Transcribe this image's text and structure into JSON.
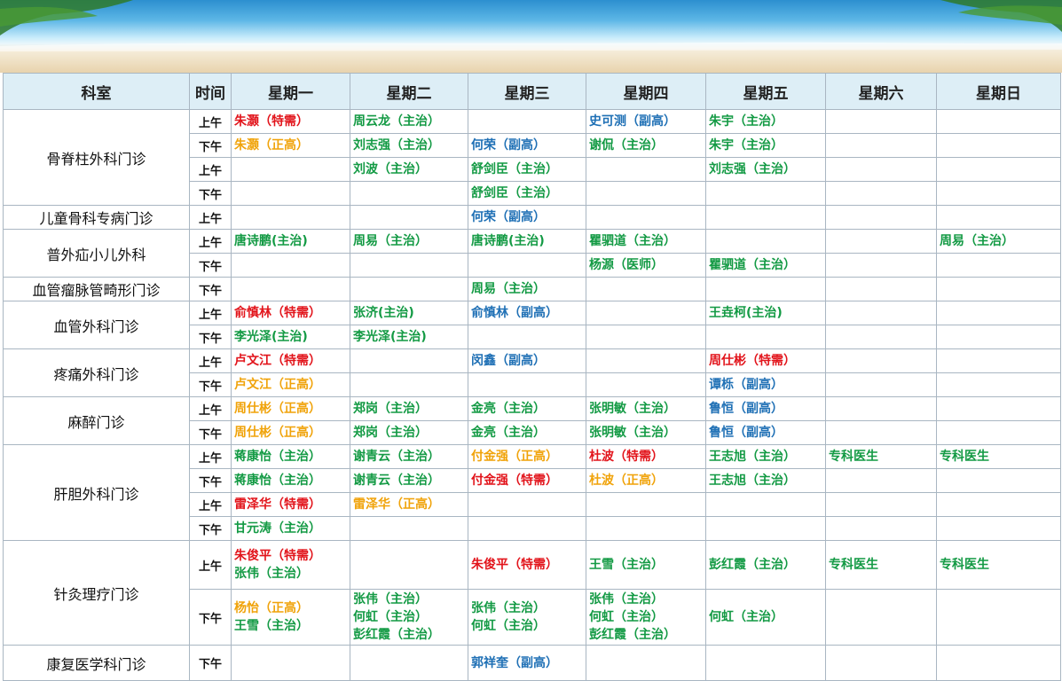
{
  "colors": {
    "red": "#e2141b",
    "green": "#139a44",
    "blue": "#1f70b5",
    "orange": "#f0a30a",
    "header_bg": "#ddeef6",
    "border": "#a9b6c2"
  },
  "headers": [
    "科室",
    "时间",
    "星期一",
    "星期二",
    "星期三",
    "星期四",
    "星期五",
    "星期六",
    "星期日"
  ],
  "rows": [
    {
      "dept": "骨脊柱外科门诊",
      "time": "上午",
      "cells": [
        [
          [
            "朱灏（特需）",
            "red"
          ]
        ],
        [
          [
            "周云龙（主治）",
            "green"
          ]
        ],
        [],
        [
          [
            "史可测（副高）",
            "blue"
          ]
        ],
        [
          [
            "朱宇（主治）",
            "green"
          ]
        ],
        [],
        []
      ]
    },
    {
      "time": "下午",
      "cells": [
        [
          [
            "朱灏（正高）",
            "orange"
          ]
        ],
        [
          [
            "刘志强（主治）",
            "green"
          ]
        ],
        [
          [
            "何荣（副高）",
            "blue"
          ]
        ],
        [
          [
            "谢侃（主治）",
            "green"
          ]
        ],
        [
          [
            "朱宇（主治）",
            "green"
          ]
        ],
        [],
        []
      ]
    },
    {
      "time": "上午",
      "cells": [
        [],
        [
          [
            "刘波（主治）",
            "green"
          ]
        ],
        [
          [
            "舒剑臣（主治）",
            "green"
          ]
        ],
        [],
        [
          [
            "刘志强（主治）",
            "green"
          ]
        ],
        [],
        []
      ]
    },
    {
      "time": "下午",
      "cells": [
        [],
        [],
        [
          [
            "舒剑臣（主治）",
            "green"
          ]
        ],
        [],
        [],
        [],
        []
      ]
    },
    {
      "dept": "儿童骨科专病门诊",
      "time": "上午",
      "cells": [
        [],
        [],
        [
          [
            "何荣（副高）",
            "blue"
          ]
        ],
        [],
        [],
        [],
        []
      ]
    },
    {
      "dept": "普外疝小儿外科",
      "time": "上午",
      "cells": [
        [
          [
            "唐诗鹏(主治)",
            "green"
          ]
        ],
        [
          [
            "周易（主治）",
            "green"
          ]
        ],
        [
          [
            "唐诗鹏(主治)",
            "green"
          ]
        ],
        [
          [
            "瞿驷道（主治）",
            "green"
          ]
        ],
        [],
        [],
        [
          [
            "周易（主治）",
            "green"
          ]
        ]
      ]
    },
    {
      "time": "下午",
      "cells": [
        [],
        [],
        [],
        [
          [
            "杨源（医师）",
            "green"
          ]
        ],
        [
          [
            "瞿驷道（主治）",
            "green"
          ]
        ],
        [],
        []
      ]
    },
    {
      "dept": "血管瘤脉管畸形门诊",
      "time": "下午",
      "cells": [
        [],
        [],
        [
          [
            "周易（主治）",
            "green"
          ]
        ],
        [],
        [],
        [],
        []
      ]
    },
    {
      "dept": "血管外科门诊",
      "time": "上午",
      "cells": [
        [
          [
            "俞慎林（特需）",
            "red"
          ]
        ],
        [
          [
            "张济(主治)",
            "green"
          ]
        ],
        [
          [
            "俞慎林（副高）",
            "blue"
          ]
        ],
        [],
        [
          [
            "王垚柯(主治)",
            "green"
          ]
        ],
        [],
        []
      ]
    },
    {
      "time": "下午",
      "cells": [
        [
          [
            "李光泽(主治)",
            "green"
          ]
        ],
        [
          [
            "李光泽(主治)",
            "green"
          ]
        ],
        [],
        [],
        [],
        [],
        []
      ]
    },
    {
      "dept": "疼痛外科门诊",
      "time": "上午",
      "cells": [
        [
          [
            "卢文江（特需）",
            "red"
          ]
        ],
        [],
        [
          [
            "闵鑫（副高）",
            "blue"
          ]
        ],
        [],
        [
          [
            "周仕彬（特需）",
            "red"
          ]
        ],
        [],
        []
      ]
    },
    {
      "time": "下午",
      "cells": [
        [
          [
            "卢文江（正高）",
            "orange"
          ]
        ],
        [],
        [],
        [],
        [
          [
            "谭栎（副高）",
            "blue"
          ]
        ],
        [],
        []
      ]
    },
    {
      "dept": "麻醉门诊",
      "time": "上午",
      "cells": [
        [
          [
            "周仕彬（正高）",
            "orange"
          ]
        ],
        [
          [
            "郑岗（主治）",
            "green"
          ]
        ],
        [
          [
            "金亮（主治）",
            "green"
          ]
        ],
        [
          [
            "张明敏（主治）",
            "green"
          ]
        ],
        [
          [
            "鲁恒（副高）",
            "blue"
          ]
        ],
        [],
        []
      ]
    },
    {
      "time": "下午",
      "cells": [
        [
          [
            "周仕彬（正高）",
            "orange"
          ]
        ],
        [
          [
            "郑岗（主治）",
            "green"
          ]
        ],
        [
          [
            "金亮（主治）",
            "green"
          ]
        ],
        [
          [
            "张明敏（主治）",
            "green"
          ]
        ],
        [
          [
            "鲁恒（副高）",
            "blue"
          ]
        ],
        [],
        []
      ]
    },
    {
      "dept": "肝胆外科门诊",
      "time": "上午",
      "cells": [
        [
          [
            "蒋康怡（主治）",
            "green"
          ]
        ],
        [
          [
            "谢青云（主治）",
            "green"
          ]
        ],
        [
          [
            "付金强（正高）",
            "orange"
          ]
        ],
        [
          [
            "杜波（特需）",
            "red"
          ]
        ],
        [
          [
            "王志旭（主治）",
            "green"
          ]
        ],
        [
          [
            "专科医生",
            "green"
          ]
        ],
        [
          [
            "专科医生",
            "green"
          ]
        ]
      ]
    },
    {
      "time": "下午",
      "cells": [
        [
          [
            "蒋康怡（主治）",
            "green"
          ]
        ],
        [
          [
            "谢青云（主治）",
            "green"
          ]
        ],
        [
          [
            "付金强（特需）",
            "red"
          ]
        ],
        [
          [
            "杜波（正高）",
            "orange"
          ]
        ],
        [
          [
            "王志旭（主治）",
            "green"
          ]
        ],
        [],
        []
      ]
    },
    {
      "time": "上午",
      "cells": [
        [
          [
            "雷泽华（特需）",
            "red"
          ]
        ],
        [
          [
            "雷泽华（正高）",
            "orange"
          ]
        ],
        [],
        [],
        [],
        [],
        []
      ]
    },
    {
      "time": "下午",
      "cells": [
        [
          [
            "甘元涛（主治）",
            "green"
          ]
        ],
        [],
        [],
        [],
        [],
        [],
        []
      ]
    },
    {
      "dept": "针灸理疗门诊",
      "time": "上午",
      "cells": [
        [
          [
            "朱俊平（特需）",
            "red"
          ],
          [
            "张伟（主治）",
            "green"
          ]
        ],
        [],
        [
          [
            "朱俊平（特需）",
            "red"
          ]
        ],
        [
          [
            "王雪（主治）",
            "green"
          ]
        ],
        [
          [
            "彭红霞（主治）",
            "green"
          ]
        ],
        [
          [
            "专科医生",
            "green"
          ]
        ],
        [
          [
            "专科医生",
            "green"
          ]
        ]
      ]
    },
    {
      "time": "下午",
      "cells": [
        [
          [
            "杨怡（正高）",
            "orange"
          ],
          [
            "王雪（主治）",
            "green"
          ]
        ],
        [
          [
            "张伟（主治）",
            "green"
          ],
          [
            "何虹（主治）",
            "green"
          ],
          [
            "彭红霞（主治）",
            "green"
          ]
        ],
        [
          [
            "张伟（主治）",
            "green"
          ],
          [
            "何虹（主治）",
            "green"
          ]
        ],
        [
          [
            "张伟（主治）",
            "green"
          ],
          [
            "何虹（主治）",
            "green"
          ],
          [
            "彭红霞（主治）",
            "green"
          ]
        ],
        [
          [
            "何虹（主治）",
            "green"
          ]
        ],
        [],
        []
      ]
    },
    {
      "dept": "康复医学科门诊",
      "time": "下午",
      "cells": [
        [],
        [],
        [
          [
            "郭祥奎（副高）",
            "blue"
          ]
        ],
        [],
        [],
        [],
        []
      ]
    }
  ]
}
